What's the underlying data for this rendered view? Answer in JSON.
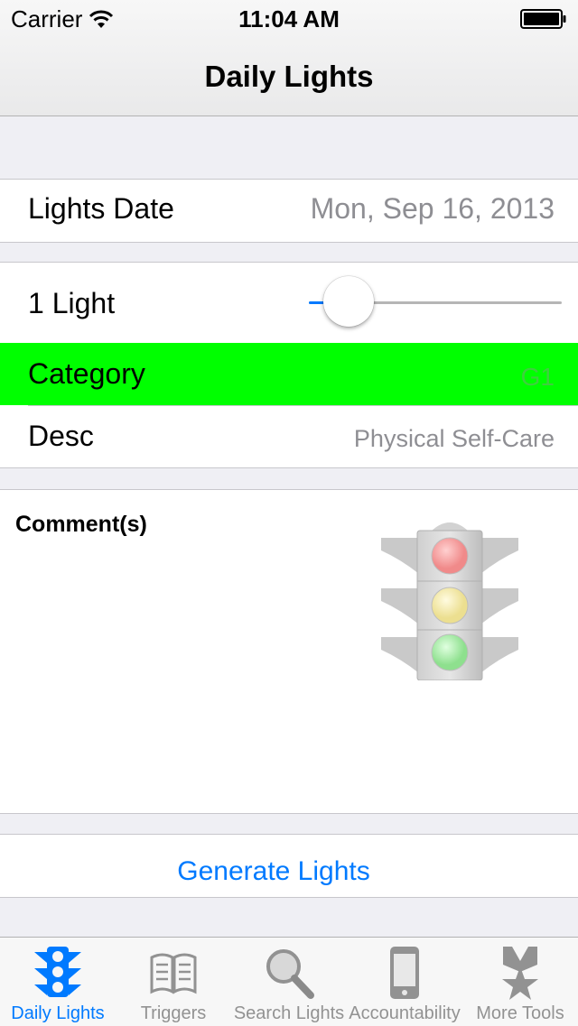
{
  "status_bar": {
    "carrier": "Carrier",
    "time": "11:04 AM"
  },
  "nav": {
    "title": "Daily Lights"
  },
  "form": {
    "date": {
      "label": "Lights Date",
      "value": "Mon, Sep 16, 2013"
    },
    "lights": {
      "label": "1 Light",
      "slider_value_fraction": 0.07
    },
    "category": {
      "label": "Category",
      "value": "G1",
      "highlight_color": "#00ff00"
    },
    "desc": {
      "label": "Desc",
      "value": "Physical Self-Care"
    },
    "comments": {
      "label": "Comment(s)"
    }
  },
  "generate_button": {
    "label": "Generate Lights"
  },
  "accent_color": "#007aff",
  "tabs": [
    {
      "label": "Daily Lights",
      "icon": "traffic-light-icon",
      "active": true
    },
    {
      "label": "Triggers",
      "icon": "book-icon",
      "active": false
    },
    {
      "label": "Search Lights",
      "icon": "magnifier-icon",
      "active": false
    },
    {
      "label": "Accountability",
      "icon": "phone-icon",
      "active": false
    },
    {
      "label": "More Tools",
      "icon": "medal-icon",
      "active": false
    }
  ]
}
